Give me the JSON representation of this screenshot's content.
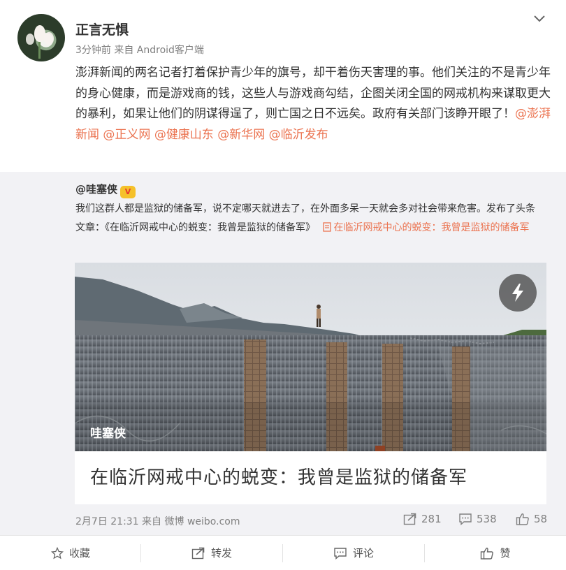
{
  "post": {
    "author": "正言无惧",
    "meta": "3分钟前 来自 Android客户端",
    "text_main": "澎湃新闻的两名记者打着保护青少年的旗号，却干着伤天害理的事。他们关注的不是青少年的身心健康，而是游戏商的钱，这些人与游戏商勾结，企图关闭全国的网戒机构来谋取更大的暴利，如果让他们的阴谋得逞了，则亡国之日不远矣。政府有关部门该睁开眼了！",
    "mentions": [
      "@澎湃新闻",
      "@正义网",
      "@健康山东",
      "@新华网",
      "@临沂发布"
    ]
  },
  "repost": {
    "author": "@哇塞侠",
    "badge_text": "V",
    "text": "我们这群人都是监狱的储备军，说不定哪天就进去了，在外面多呆一天就会多对社会带来危害。发布了头条文章：《在临沂网戒中心的蜕变：我曾是监狱的储备军》",
    "link_text": "在临沂网戒中心的蜕变：我曾是监狱的储备军",
    "article": {
      "image_source": "哇塞侠",
      "title": "在临沂网戒中心的蜕变：我曾是监狱的储备军"
    },
    "time_source": "2月7日 21:31 来自 微博 weibo.com",
    "stats": {
      "reposts": "281",
      "comments": "538",
      "likes": "58"
    }
  },
  "actions": {
    "favorite": "收藏",
    "forward": "转发",
    "comment": "评论",
    "like": "赞"
  },
  "colors": {
    "mention": "#eb7350",
    "repost_bg": "#f2f2f5",
    "meta": "#808080"
  },
  "icons": [
    "chevron-down-icon",
    "flash-icon",
    "forward-icon",
    "comment-icon",
    "like-icon",
    "star-icon",
    "document-icon"
  ]
}
